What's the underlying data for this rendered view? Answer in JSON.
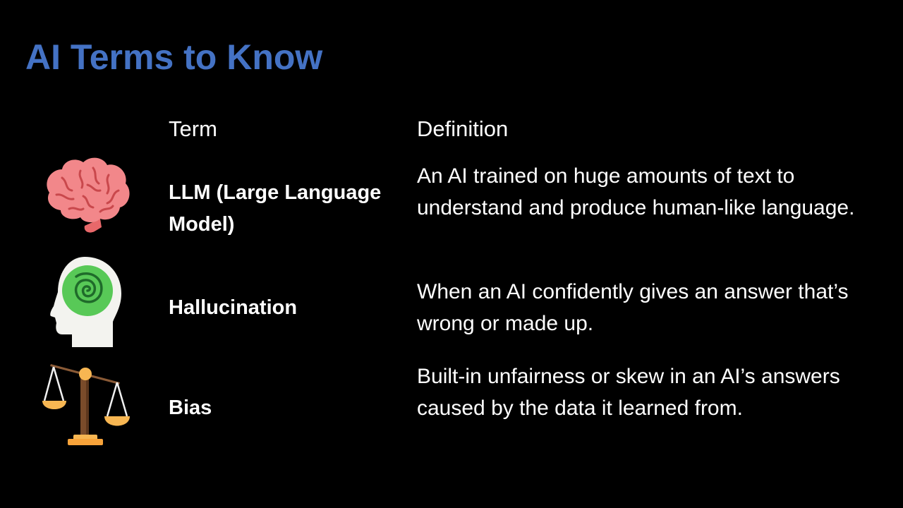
{
  "slide": {
    "title": "AI Terms to Know",
    "title_color": "#4472c4",
    "headers": {
      "term": "Term",
      "definition": "Definition"
    },
    "rows": [
      {
        "icon": "brain-icon",
        "term": "LLM (Large Language Model)",
        "definition": "An AI trained on huge amounts of text to understand and produce human-like language."
      },
      {
        "icon": "head-spiral-icon",
        "term": "Hallucination",
        "definition": "When an AI confidently gives an answer that’s wrong or made up."
      },
      {
        "icon": "balance-scale-icon",
        "term": "Bias",
        "definition": "Built-in unfairness or skew in an AI’s answers caused by the data it learned from."
      }
    ]
  }
}
